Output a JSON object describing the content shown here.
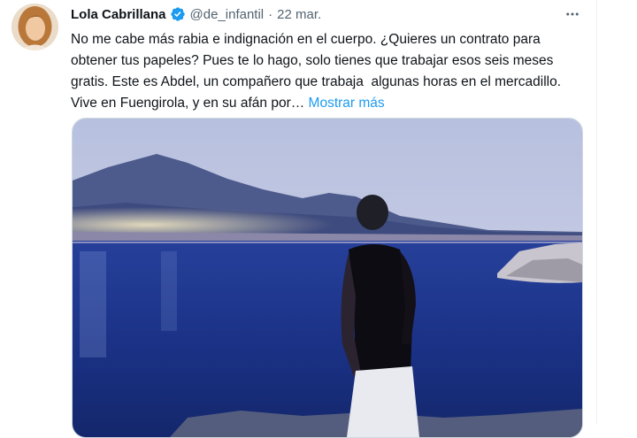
{
  "author": {
    "name": "Lola Cabrillana",
    "handle": "@de_infantil",
    "separator": "·",
    "date": "22 mar."
  },
  "tweet": {
    "text": "No me cabe más rabia e indignación en el cuerpo. ¿Quieres un contrato para obtener tus papeles? Pues te lo hago, solo tienes que trabajar esos seis meses gratis. Este es Abdel, un compañero que trabaja  algunas horas en el mercadillo. Vive en Fuengirola, y en su afán por… ",
    "show_more_label": "Mostrar más"
  },
  "icons": {
    "verified": "verified-badge-icon",
    "more": "more-options-icon"
  },
  "colors": {
    "accent": "#1d9bf0",
    "secondary_text": "#536471",
    "primary_text": "#0f1419"
  }
}
